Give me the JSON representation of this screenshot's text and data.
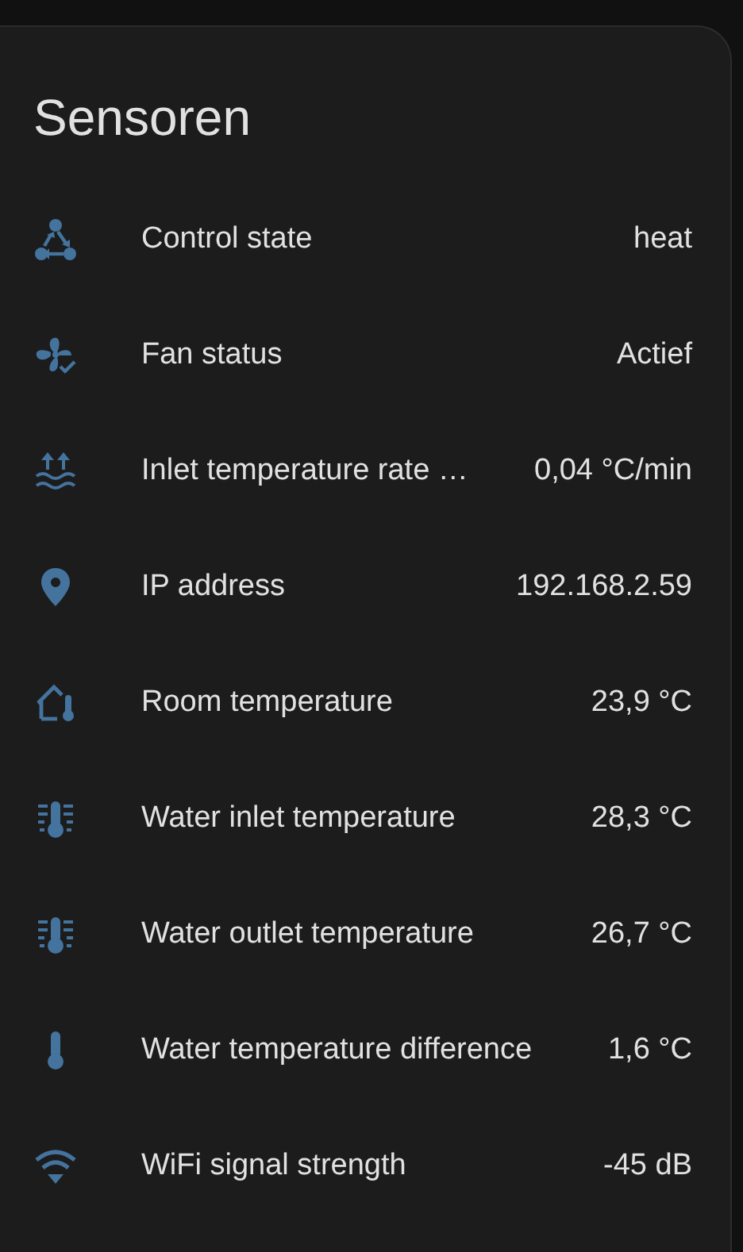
{
  "card": {
    "title": "Sensoren",
    "rows": [
      {
        "kind": "state",
        "label": "Control state",
        "value": "heat"
      },
      {
        "kind": "fan",
        "label": "Fan status",
        "value": "Actief"
      },
      {
        "kind": "rate",
        "label": "Inlet temperature rate …",
        "value": "0,04 °C/min"
      },
      {
        "kind": "location",
        "label": "IP address",
        "value": "192.168.2.59"
      },
      {
        "kind": "room",
        "label": "Room temperature",
        "value": "23,9 °C"
      },
      {
        "kind": "water",
        "label": "Water inlet temperature",
        "value": "28,3 °C"
      },
      {
        "kind": "water",
        "label": "Water outlet temperature",
        "value": "26,7 °C"
      },
      {
        "kind": "thermometer",
        "label": "Water temperature difference",
        "value": "1,6 °C"
      },
      {
        "kind": "wifi",
        "label": "WiFi signal strength",
        "value": "-45 dB"
      }
    ]
  }
}
